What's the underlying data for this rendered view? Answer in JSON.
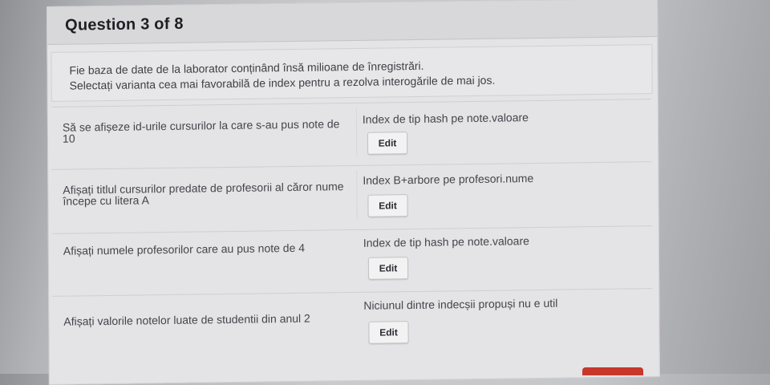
{
  "question": {
    "title": "Question 3 of 8",
    "prompt_line_1": "Fie baza de date de la laborator conținând însă milioane de înregistrări.",
    "prompt_line_2": "Selectați varianta cea mai favorabilă de index pentru a rezolva interogările de mai jos."
  },
  "rows": [
    {
      "query": "Să se afișeze id-urile cursurilor la care s-au pus note de 10",
      "answer": "Index de tip hash pe note.valoare",
      "button_label": "Edit"
    },
    {
      "query": "Afișați titlul cursurilor predate de profesorii al căror nume începe cu litera A",
      "answer": "Index B+arbore pe profesori.nume",
      "button_label": "Edit"
    },
    {
      "query": "Afișați numele profesorilor care au pus note de 4",
      "answer": "Index de tip hash pe note.valoare",
      "button_label": "Edit"
    },
    {
      "query": "Afișați valorile notelor luate de studentii din anul 2",
      "answer": "Niciunul dintre indecșii propuși nu e util",
      "button_label": "Edit"
    }
  ],
  "colors": {
    "panel": "#e4e4e6",
    "header": "#d8d8db",
    "text": "#44454c",
    "accent_button": "#c7372b"
  }
}
